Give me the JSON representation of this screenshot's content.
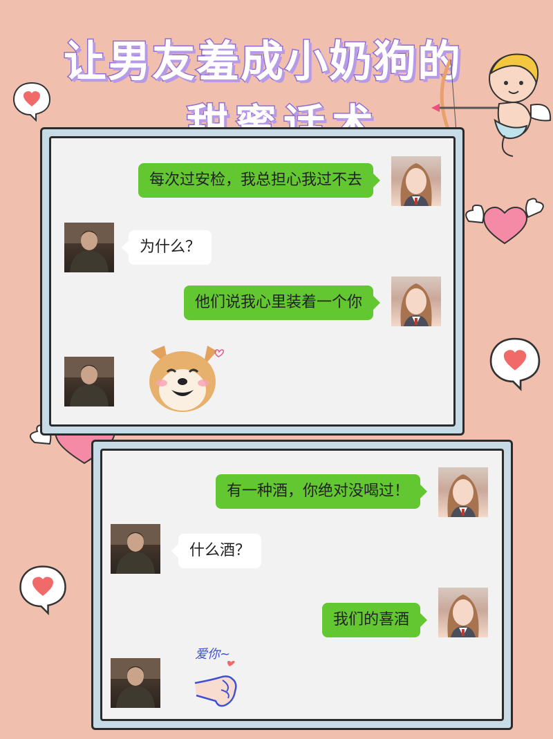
{
  "title": {
    "line1": "让男友羞成小奶狗的",
    "line2": "甜蜜话术"
  },
  "chat1": {
    "messages": [
      {
        "side": "right",
        "sender": "girl",
        "text": "每次过安检，我总担心我过不去"
      },
      {
        "side": "left",
        "sender": "boy",
        "text": "为什么？"
      },
      {
        "side": "right",
        "sender": "girl",
        "text": "他们说我心里装着一个你"
      },
      {
        "side": "left",
        "sender": "boy",
        "type": "sticker",
        "sticker": "shiba-dog-sticker"
      }
    ]
  },
  "chat2": {
    "messages": [
      {
        "side": "right",
        "sender": "girl",
        "text": "有一种酒，你绝对没喝过！"
      },
      {
        "side": "left",
        "sender": "boy",
        "text": "什么酒？"
      },
      {
        "side": "right",
        "sender": "girl",
        "text": "我们的喜酒"
      },
      {
        "side": "left",
        "sender": "boy",
        "type": "sticker",
        "sticker": "love-you-hand-sticker"
      }
    ]
  },
  "stickers": {
    "love_you_text": "爱你~"
  },
  "colors": {
    "background": "#f0bfad",
    "bubble_right": "#63c732",
    "bubble_left": "#ffffff",
    "title_outline": "#8e6bd6",
    "panel_frame": "#c6dbe6",
    "heart": "#f06a6a"
  }
}
